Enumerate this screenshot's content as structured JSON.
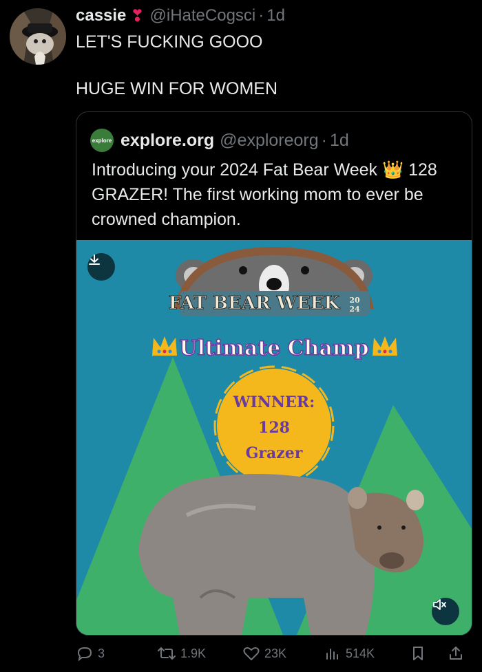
{
  "post": {
    "author_name": "cassie",
    "author_handle": "@iHateCogsci",
    "separator": "·",
    "time": "1d",
    "text_line1": "LET'S FUCKING GOOO",
    "text_line2": "HUGE WIN FOR WOMEN"
  },
  "quoted": {
    "logo_text": "explore",
    "name": "explore.org",
    "handle": "@exploreorg",
    "separator": "·",
    "time": "1d",
    "text": "Introducing your 2024 Fat Bear Week 👑 128 GRAZER! The first working mom to ever be crowned champion.",
    "media": {
      "banner": "FAT BEAR WEEK",
      "year_top": "20",
      "year_bottom": "24",
      "subtitle": "Ultimate Champ",
      "badge_line1": "WINNER:",
      "badge_line2": "128",
      "badge_line3": "Grazer"
    }
  },
  "actions": {
    "replies": "3",
    "reposts": "1.9K",
    "likes": "23K",
    "views": "514K"
  },
  "colors": {
    "background": "#000000",
    "text": "#e7e9ea",
    "muted": "#71767b",
    "border": "#2f3336",
    "media_bg": "#1f8aa8",
    "mountain": "#3fb06a",
    "badge": "#f5b81c"
  },
  "icons": [
    "heart-emoji-icon",
    "download-icon",
    "mute-icon",
    "reply-icon",
    "repost-icon",
    "like-icon",
    "views-icon",
    "bookmark-icon",
    "share-icon"
  ]
}
